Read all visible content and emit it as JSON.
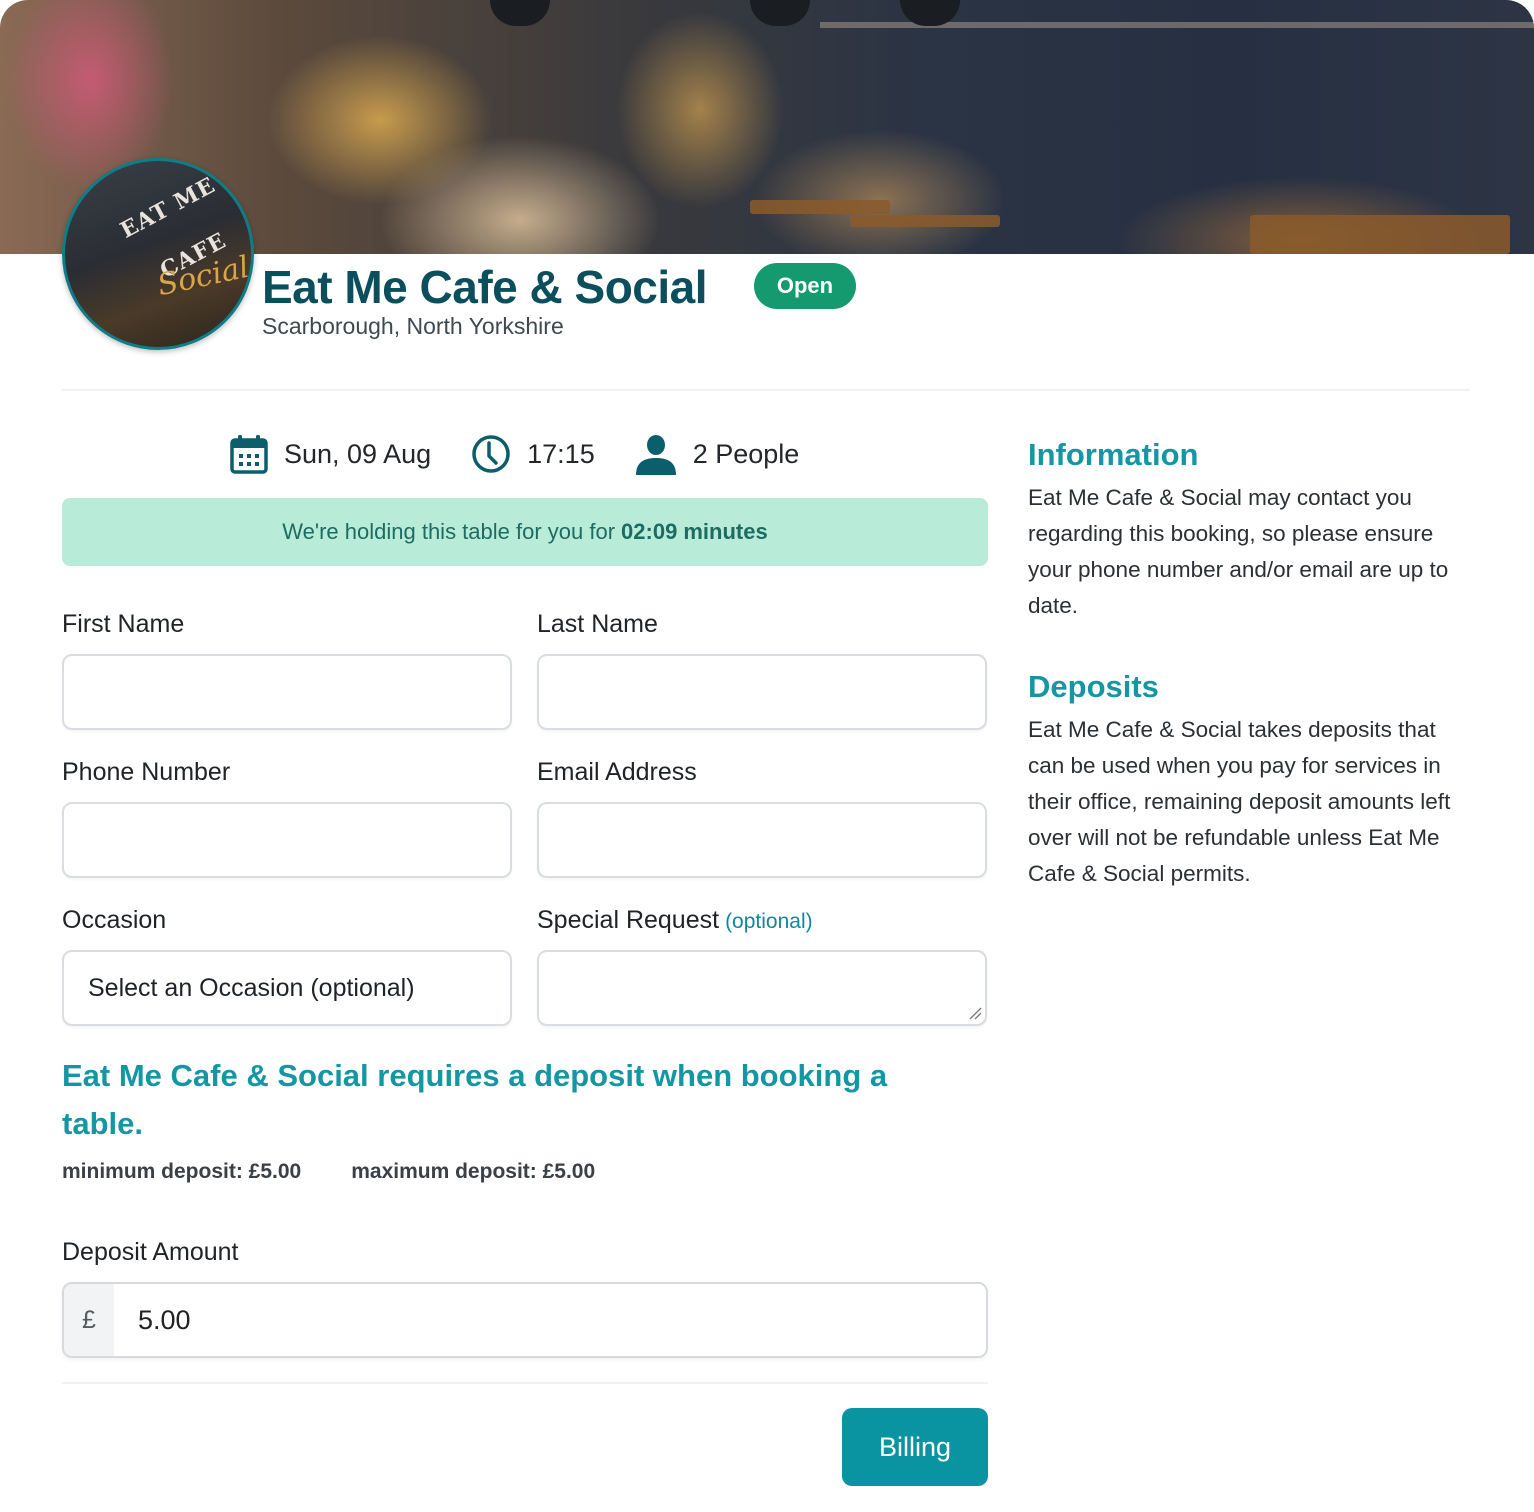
{
  "venue": {
    "name": "Eat Me Cafe & Social",
    "status": "Open",
    "location": "Scarborough, North Yorkshire",
    "logo_text_top": "EAT ME CAFE",
    "logo_text_script": "Social"
  },
  "booking": {
    "date": "Sun, 09 Aug",
    "time": "17:15",
    "party": "2 People",
    "date_icon": "calendar-icon",
    "time_icon": "clock-icon",
    "party_icon": "person-icon"
  },
  "hold": {
    "prefix": "We're holding this table for you for",
    "countdown": "02:09",
    "suffix": "minutes"
  },
  "form": {
    "first_name": {
      "label": "First Name",
      "value": ""
    },
    "last_name": {
      "label": "Last Name",
      "value": ""
    },
    "phone": {
      "label": "Phone Number",
      "value": ""
    },
    "email": {
      "label": "Email Address",
      "value": ""
    },
    "occasion": {
      "label": "Occasion",
      "selected": "Select an Occasion (optional)"
    },
    "special_request": {
      "label": "Special Request",
      "optional_tag": "(optional)",
      "value": ""
    }
  },
  "deposit": {
    "notice": "Eat Me Cafe & Social requires a deposit when booking a table.",
    "minimum": "minimum deposit: £5.00",
    "maximum": "maximum deposit: £5.00",
    "amount_label": "Deposit Amount",
    "currency_symbol": "£",
    "amount": "5.00"
  },
  "actions": {
    "billing_label": "Billing"
  },
  "sidebar": {
    "information_title": "Information",
    "information_text": "Eat Me Cafe & Social may contact you regarding this booking, so please ensure your phone number and/or email are up to date.",
    "deposits_title": "Deposits",
    "deposits_text": "Eat Me Cafe & Social takes deposits that can be used when you pay for services in their office, remaining deposit amounts left over will not be refundable unless Eat Me Cafe & Social permits."
  },
  "colors": {
    "brand_dark": "#0b4f5c",
    "accent_teal": "#1596a3",
    "button_teal": "#0a94a1",
    "open_green": "#149a6e",
    "hold_banner_bg": "#b8ecd8"
  }
}
